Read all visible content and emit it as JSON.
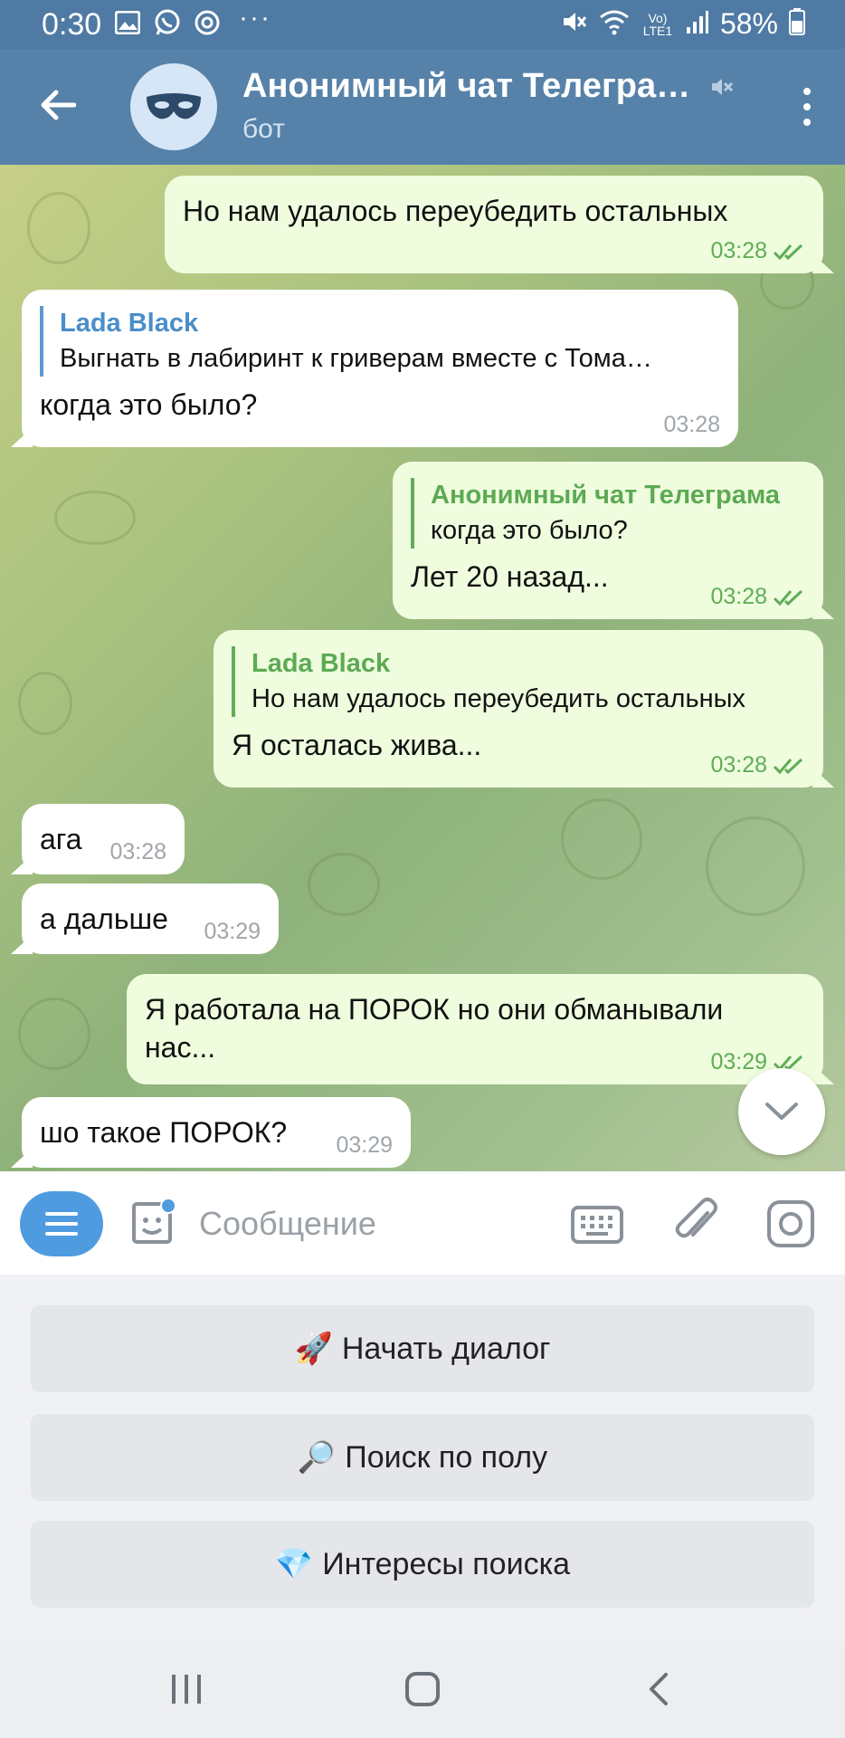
{
  "status_bar": {
    "time": "0:30",
    "battery": "58%",
    "network_label": "Vo) LTE1",
    "left_icons": [
      "gallery-icon",
      "whatsapp-icon",
      "sync-icon"
    ],
    "right_icons": [
      "mute-icon",
      "wifi-icon",
      "signal-icon",
      "battery-icon"
    ]
  },
  "header": {
    "title": "Анонимный чат Телегра…",
    "subtitle": "бот",
    "avatar_icon": "mask-icon",
    "muted": true
  },
  "messages": [
    {
      "dir": "out",
      "text": "Но нам удалось переубедить остальных",
      "time": "03:28",
      "read": true
    },
    {
      "dir": "in",
      "quote_author": "Lada Black",
      "quote_text": "Выгнать в лабиринт к гриверам вместе с Тома…",
      "text": "когда это было?",
      "time": "03:28"
    },
    {
      "dir": "out",
      "quote_author": "Анонимный чат Телеграма",
      "quote_text": "когда это было?",
      "text": "Лет 20 назад...",
      "time": "03:28",
      "read": true
    },
    {
      "dir": "out",
      "quote_author": "Lada Black",
      "quote_text": "Но нам удалось переубедить остальных",
      "text": "Я осталась жива...",
      "time": "03:28",
      "read": true
    },
    {
      "dir": "in",
      "text": "ага",
      "time": "03:28"
    },
    {
      "dir": "in",
      "text": "а дальше",
      "time": "03:29"
    },
    {
      "dir": "out",
      "text_line1": "Я работала на ПОРОК но они обманывали",
      "text_line2": "нас...",
      "time": "03:29",
      "read": true
    },
    {
      "dir": "in",
      "text": "шо такое ПОРОК?",
      "time": "03:29"
    }
  ],
  "composer": {
    "placeholder": "Сообщение"
  },
  "bot_keyboard": [
    {
      "emoji": "🚀",
      "label": "Начать диалог"
    },
    {
      "emoji": "🔎",
      "label": "Поиск по полу"
    },
    {
      "emoji": "💎",
      "label": "Интересы поиска"
    }
  ],
  "colors": {
    "header": "#5682a9",
    "status_bar": "#4f7aa3",
    "incoming_bubble": "#ffffff",
    "outgoing_bubble": "#effdde",
    "outgoing_time": "#5fad56",
    "accent_blue": "#4f9be0"
  }
}
